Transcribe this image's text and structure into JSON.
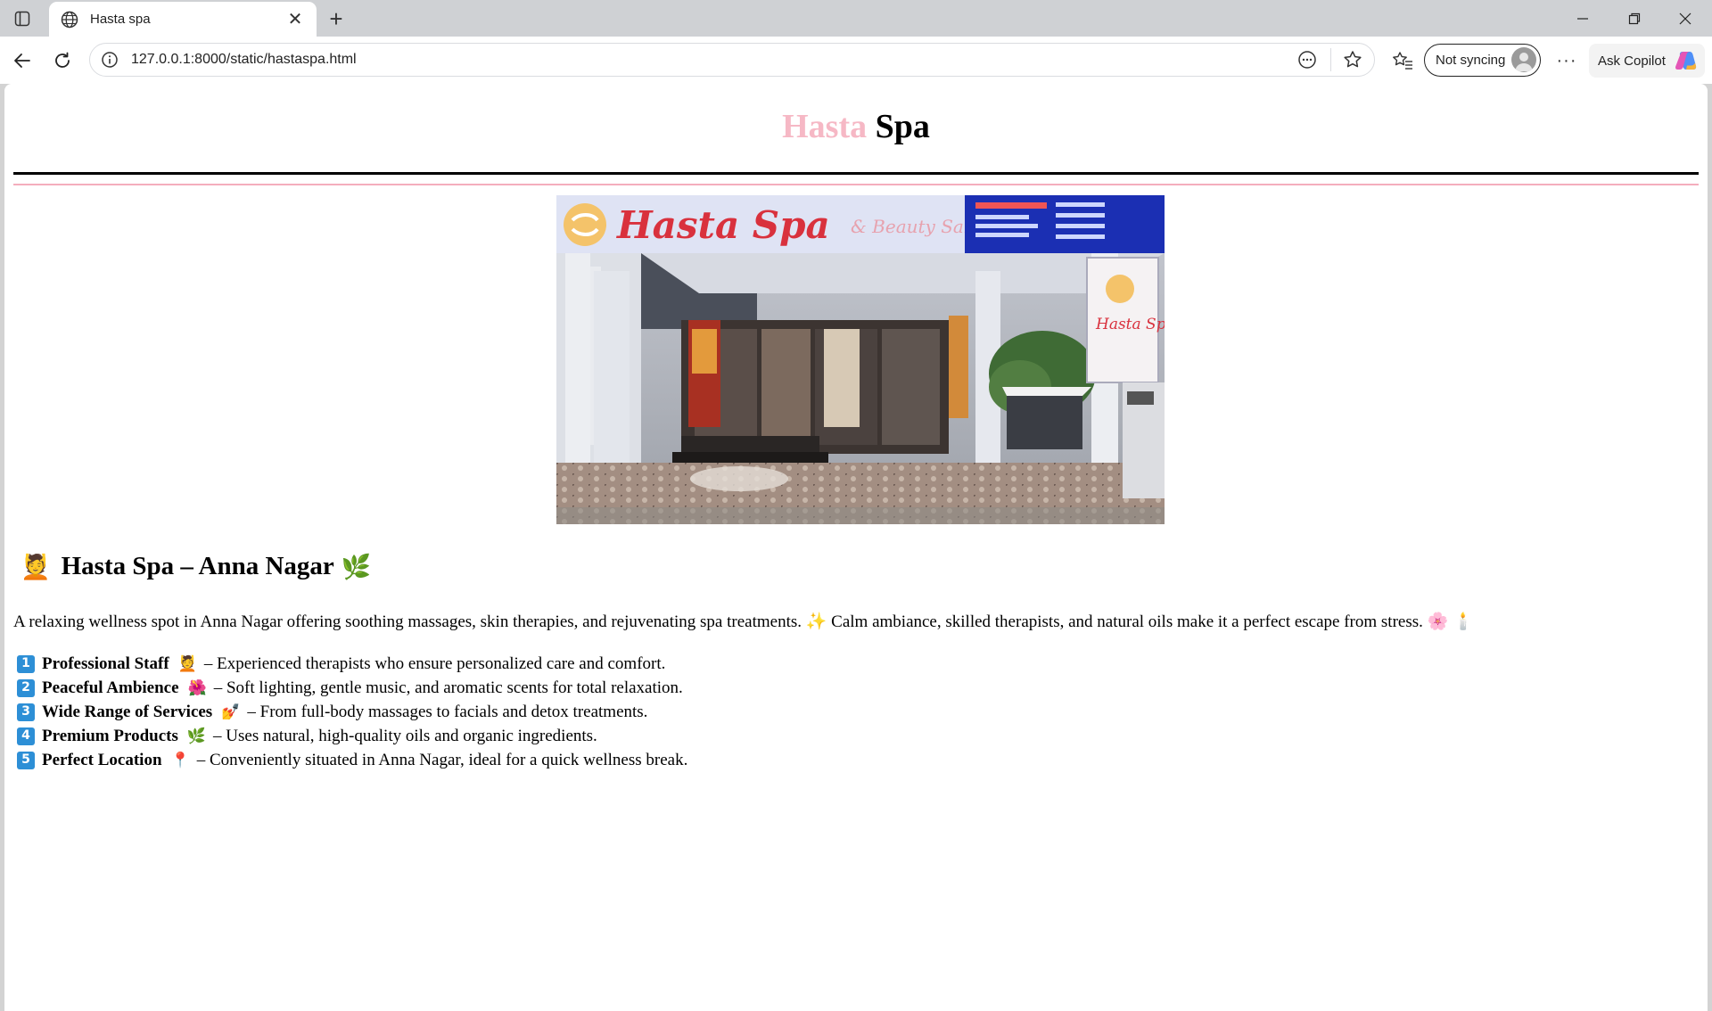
{
  "browser": {
    "tab_title": "Hasta spa",
    "new_tab_symbol": "+",
    "close_tab_symbol": "✕",
    "url": "127.0.0.1:8000/static/hastaspa.html",
    "sync_label": "Not syncing",
    "more_symbol": "···",
    "copilot_label": "Ask Copilot"
  },
  "page": {
    "title_part1": "Hasta",
    "title_part2": "Spa",
    "section_title": "Hasta Spa – Anna Nagar",
    "section_emoji_left": "💆",
    "section_emoji_right": "🌿",
    "intro": "A relaxing wellness spot in Anna Nagar offering soothing massages, skin therapies, and rejuvenating spa treatments. ✨ Calm ambiance, skilled therapists, and natural oils make it a perfect escape from stress. 🌸 🕯️",
    "features": [
      {
        "num": "1",
        "title": "Professional Staff",
        "emoji": "💆",
        "desc": "– Experienced therapists who ensure personalized care and comfort."
      },
      {
        "num": "2",
        "title": "Peaceful Ambience",
        "emoji": "🌺",
        "desc": "– Soft lighting, gentle music, and aromatic scents for total relaxation."
      },
      {
        "num": "3",
        "title": "Wide Range of Services",
        "emoji": "💅",
        "desc": "– From full-body massages to facials and detox treatments."
      },
      {
        "num": "4",
        "title": "Premium Products",
        "emoji": "🌿",
        "desc": "– Uses natural, high-quality oils and organic ingredients."
      },
      {
        "num": "5",
        "title": "Perfect Location",
        "emoji": "📍",
        "desc": "– Conveniently situated in Anna Nagar, ideal for a quick wellness break."
      }
    ],
    "photo_sign_text": "Hasta Spa",
    "photo_sign_sub": "& Beauty Salon",
    "photo_side_sign": "Hasta Spa"
  }
}
